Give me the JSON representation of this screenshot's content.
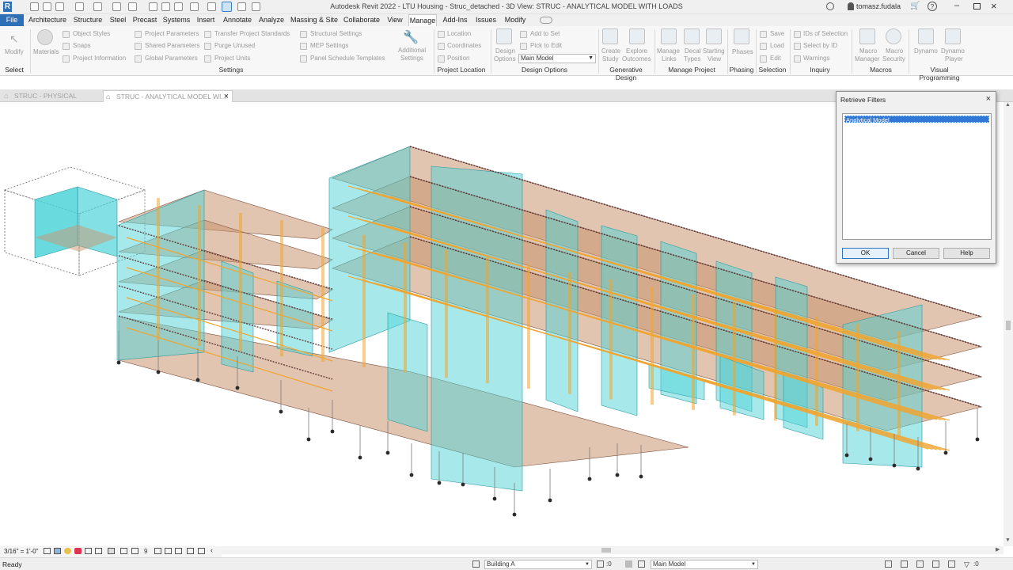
{
  "window": {
    "title": "Autodesk Revit 2022 - LTU Housing - Struc_detached - 3D View: STRUC - ANALYTICAL MODEL WITH LOADS",
    "user": "tomasz.fudala"
  },
  "ribbon_tabs": [
    "File",
    "Architecture",
    "Structure",
    "Steel",
    "Precast",
    "Systems",
    "Insert",
    "Annotate",
    "Analyze",
    "Massing & Site",
    "Collaborate",
    "View",
    "Manage",
    "Add-Ins",
    "Issues",
    "Modify"
  ],
  "active_tab": "Manage",
  "ribbon": {
    "select_group": {
      "modify": "Modify",
      "label": "Select"
    },
    "settings": {
      "materials": "Materials",
      "object_styles": "Object Styles",
      "snaps": "Snaps",
      "project_information": "Project Information",
      "project_parameters": "Project Parameters",
      "shared_parameters": "Shared Parameters",
      "global_parameters": "Global Parameters",
      "transfer_project_standards": "Transfer Project Standards",
      "purge_unused": "Purge Unused",
      "project_units": "Project Units",
      "structural_settings": "Structural Settings",
      "mep_settings": "MEP Settings",
      "panel_schedule_templates": "Panel Schedule Templates",
      "additional_settings_1": "Additional",
      "additional_settings_2": "Settings",
      "label": "Settings"
    },
    "project_location": {
      "location": "Location",
      "coordinates": "Coordinates",
      "position": "Position",
      "label": "Project Location"
    },
    "design_options": {
      "design_1": "Design",
      "design_2": "Options",
      "add_to_set": "Add to Set",
      "pick_to_edit": "Pick to Edit",
      "main_model": "Main Model",
      "label": "Design Options"
    },
    "generative_design": {
      "create_1": "Create",
      "create_2": "Study",
      "explore_1": "Explore",
      "explore_2": "Outcomes",
      "label": "Generative Design"
    },
    "manage_project": {
      "manage_1": "Manage",
      "manage_2": "Links",
      "decal_1": "Decal",
      "decal_2": "Types",
      "starting_1": "Starting",
      "starting_2": "View",
      "label": "Manage Project"
    },
    "phasing": {
      "phases": "Phases",
      "label": "Phasing"
    },
    "selection": {
      "save": "Save",
      "load": "Load",
      "edit": "Edit",
      "label": "Selection"
    },
    "inquiry": {
      "ids": "IDs of Selection",
      "select_by_id": "Select by ID",
      "warnings": "Warnings",
      "label": "Inquiry"
    },
    "macros": {
      "macro_manager_1": "Macro",
      "macro_manager_2": "Manager",
      "macro_security_1": "Macro",
      "macro_security_2": "Security",
      "label": "Macros"
    },
    "visual_programming": {
      "dynamo": "Dynamo",
      "dynamo_player_1": "Dynamo",
      "dynamo_player_2": "Player",
      "label": "Visual Programming"
    }
  },
  "view_tabs": [
    {
      "label": "STRUC - PHYSICAL MODEL",
      "active": false
    },
    {
      "label": "STRUC - ANALYTICAL MODEL WI...",
      "active": true
    }
  ],
  "dialog": {
    "title": "Retrieve Filters",
    "items": [
      "Analytical Model"
    ],
    "ok": "OK",
    "cancel": "Cancel",
    "help": "Help"
  },
  "view_control": {
    "scale": "3/16\" = 1'-0\"",
    "count": "9"
  },
  "status": {
    "text": "Ready",
    "worksets": ":0",
    "building": "Building A",
    "main_model": "Main Model",
    "filter_count": ":0"
  },
  "colors": {
    "slab": "#c9956f",
    "wall": "#4fd3d8",
    "beam": "#f0a530",
    "column": "#5c3030"
  }
}
